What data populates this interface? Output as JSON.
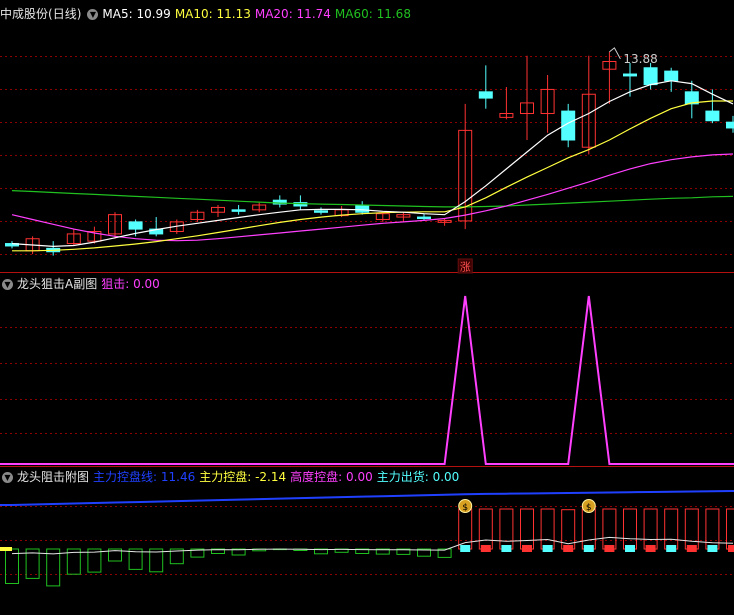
{
  "colors": {
    "bg": "#000000",
    "grid": "#8b0000",
    "axis": "#b41010",
    "up": "#ff3232",
    "down": "#54ffff",
    "ma5": "#ffffff",
    "ma10": "#ffff40",
    "ma20": "#ff40ff",
    "ma60": "#20c020",
    "pink": "#ff40ff",
    "blue": "#2040ff",
    "white": "#e6e6e6",
    "yellow": "#ffff40",
    "cyan": "#54ffff"
  },
  "main": {
    "stock_name": "中成股份",
    "period": "(日线)",
    "ma5_label": "MA5: 10.99",
    "ma10_label": "MA10: 11.13",
    "ma20_label": "MA20: 11.74",
    "ma60_label": "MA60: 11.68",
    "high_marker": "13.88",
    "limit_up_badge": "涨"
  },
  "sub1": {
    "title": "龙头狙击A副图",
    "value_label": "狙击: 0.00"
  },
  "sub2": {
    "title": "龙头阻击附图",
    "line_label": "主力控盘线: 11.46",
    "control_label": "主力控盘: -2.14",
    "height_label": "高度控盘: 0.00",
    "shipment_label": "主力出货: 0.00",
    "money_icon": "$"
  },
  "chart_data": {
    "type": "candlestick",
    "price_range": [
      9.6,
      14.5
    ],
    "candles": [
      {
        "o": 9.9,
        "h": 9.95,
        "l": 9.8,
        "c": 9.85
      },
      {
        "o": 9.75,
        "h": 10.05,
        "l": 9.68,
        "c": 10.0
      },
      {
        "o": 9.8,
        "h": 9.95,
        "l": 9.65,
        "c": 9.73
      },
      {
        "o": 9.9,
        "h": 10.2,
        "l": 9.85,
        "c": 10.1
      },
      {
        "o": 9.95,
        "h": 10.25,
        "l": 9.9,
        "c": 10.15
      },
      {
        "o": 10.1,
        "h": 10.55,
        "l": 10.0,
        "c": 10.5
      },
      {
        "o": 10.35,
        "h": 10.4,
        "l": 10.05,
        "c": 10.2
      },
      {
        "o": 10.2,
        "h": 10.45,
        "l": 10.05,
        "c": 10.1
      },
      {
        "o": 10.15,
        "h": 10.4,
        "l": 10.1,
        "c": 10.35
      },
      {
        "o": 10.4,
        "h": 10.6,
        "l": 10.35,
        "c": 10.55
      },
      {
        "o": 10.55,
        "h": 10.7,
        "l": 10.45,
        "c": 10.65
      },
      {
        "o": 10.6,
        "h": 10.7,
        "l": 10.5,
        "c": 10.58
      },
      {
        "o": 10.6,
        "h": 10.75,
        "l": 10.55,
        "c": 10.7
      },
      {
        "o": 10.8,
        "h": 10.9,
        "l": 10.65,
        "c": 10.72
      },
      {
        "o": 10.75,
        "h": 10.9,
        "l": 10.6,
        "c": 10.68
      },
      {
        "o": 10.58,
        "h": 10.65,
        "l": 10.5,
        "c": 10.56
      },
      {
        "o": 10.48,
        "h": 10.68,
        "l": 10.45,
        "c": 10.6
      },
      {
        "o": 10.7,
        "h": 10.78,
        "l": 10.5,
        "c": 10.55
      },
      {
        "o": 10.4,
        "h": 10.55,
        "l": 10.35,
        "c": 10.52
      },
      {
        "o": 10.45,
        "h": 10.55,
        "l": 10.35,
        "c": 10.5
      },
      {
        "o": 10.45,
        "h": 10.52,
        "l": 10.38,
        "c": 10.43
      },
      {
        "o": 10.34,
        "h": 10.42,
        "l": 10.27,
        "c": 10.38
      },
      {
        "o": 10.37,
        "h": 12.8,
        "l": 10.2,
        "c": 12.25
      },
      {
        "o": 13.05,
        "h": 13.6,
        "l": 12.7,
        "c": 12.92
      },
      {
        "o": 12.52,
        "h": 13.15,
        "l": 12.48,
        "c": 12.6
      },
      {
        "o": 12.6,
        "h": 13.8,
        "l": 12.05,
        "c": 12.82
      },
      {
        "o": 12.6,
        "h": 13.4,
        "l": 12.2,
        "c": 13.1
      },
      {
        "o": 12.65,
        "h": 12.8,
        "l": 11.9,
        "c": 12.05
      },
      {
        "o": 11.9,
        "h": 13.8,
        "l": 11.75,
        "c": 13.0
      },
      {
        "o": 13.52,
        "h": 13.88,
        "l": 12.8,
        "c": 13.68
      },
      {
        "o": 13.42,
        "h": 13.65,
        "l": 12.95,
        "c": 13.38
      },
      {
        "o": 13.55,
        "h": 13.65,
        "l": 13.1,
        "c": 13.2
      },
      {
        "o": 13.48,
        "h": 13.55,
        "l": 13.05,
        "c": 13.28
      },
      {
        "o": 13.05,
        "h": 13.28,
        "l": 12.5,
        "c": 12.8
      },
      {
        "o": 12.65,
        "h": 13.1,
        "l": 12.4,
        "c": 12.45
      },
      {
        "o": 12.42,
        "h": 12.55,
        "l": 12.2,
        "c": 12.3
      }
    ],
    "ma5": [
      9.9,
      9.87,
      9.84,
      9.86,
      9.93,
      10.02,
      10.11,
      10.19,
      10.26,
      10.32,
      10.38,
      10.44,
      10.5,
      10.55,
      10.6,
      10.61,
      10.61,
      10.6,
      10.57,
      10.55,
      10.52,
      10.5,
      10.77,
      11.1,
      11.45,
      11.8,
      12.15,
      12.4,
      12.6,
      12.85,
      13.05,
      13.2,
      13.28,
      13.22,
      13.0,
      12.8
    ],
    "ma10": [
      9.75,
      9.75,
      9.76,
      9.78,
      9.81,
      9.85,
      9.89,
      9.94,
      10.0,
      10.06,
      10.13,
      10.2,
      10.27,
      10.34,
      10.4,
      10.45,
      10.49,
      10.52,
      10.54,
      10.55,
      10.56,
      10.56,
      10.66,
      10.85,
      11.07,
      11.28,
      11.48,
      11.68,
      11.85,
      12.05,
      12.28,
      12.5,
      12.7,
      12.82,
      12.86,
      12.86
    ],
    "ma20": [
      10.5,
      10.4,
      10.3,
      10.2,
      10.12,
      10.05,
      10.0,
      9.97,
      9.96,
      9.97,
      10.0,
      10.04,
      10.08,
      10.12,
      10.16,
      10.2,
      10.24,
      10.28,
      10.32,
      10.35,
      10.38,
      10.42,
      10.49,
      10.58,
      10.68,
      10.8,
      10.92,
      11.05,
      11.18,
      11.32,
      11.45,
      11.56,
      11.64,
      11.7,
      11.74,
      11.76
    ],
    "ma60": [
      11.0,
      10.98,
      10.96,
      10.94,
      10.92,
      10.9,
      10.88,
      10.86,
      10.84,
      10.82,
      10.8,
      10.78,
      10.76,
      10.74,
      10.73,
      10.72,
      10.71,
      10.7,
      10.69,
      10.68,
      10.67,
      10.66,
      10.66,
      10.67,
      10.68,
      10.7,
      10.72,
      10.74,
      10.76,
      10.78,
      10.8,
      10.82,
      10.84,
      10.85,
      10.87,
      10.88
    ],
    "limit_up_index": 22,
    "high_index": 29,
    "sub1_sniper": [
      0,
      0,
      0,
      0,
      0,
      0,
      0,
      0,
      0,
      0,
      0,
      0,
      0,
      0,
      0,
      0,
      0,
      0,
      0,
      0,
      0,
      0,
      1,
      0,
      0,
      0,
      0,
      0,
      1,
      0,
      0,
      0,
      0,
      0,
      0,
      0
    ],
    "sub2_money_indices": [
      22,
      28
    ],
    "sub2_line": [
      9.4,
      9.42,
      9.44,
      9.46,
      9.48,
      9.5,
      9.52,
      9.54,
      9.56,
      9.58,
      9.6,
      9.62,
      9.64,
      9.66,
      9.68,
      9.7,
      9.72,
      9.74,
      9.76,
      9.78,
      9.8,
      9.82,
      9.84,
      9.85,
      9.86,
      9.87,
      9.88,
      9.89,
      9.9,
      9.91,
      9.92,
      9.93,
      9.94,
      9.95,
      9.96,
      9.97
    ]
  }
}
